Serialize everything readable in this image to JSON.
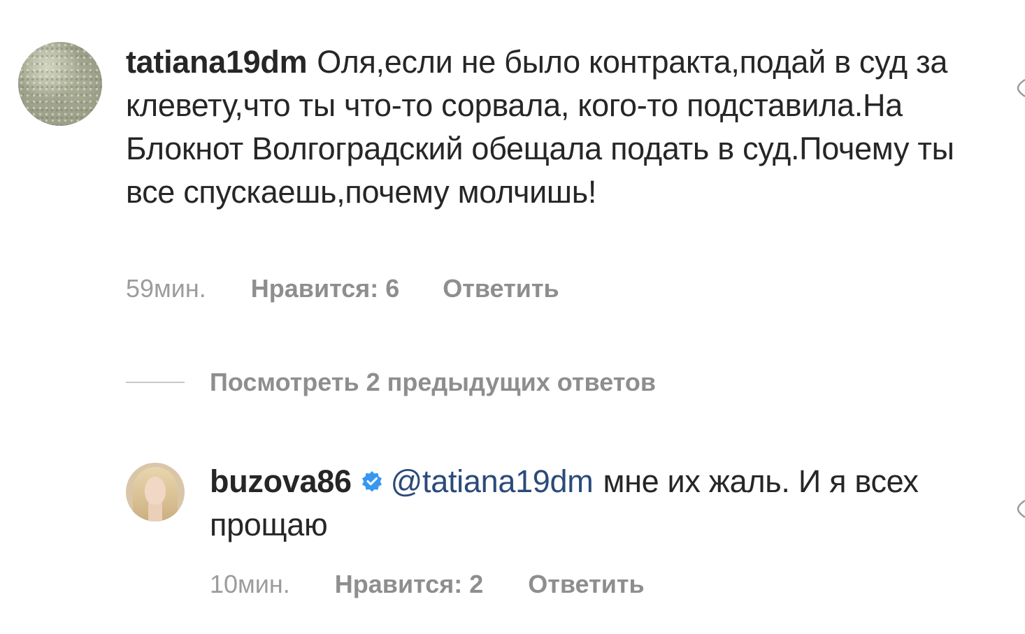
{
  "comments": [
    {
      "username": "tatiana19dm",
      "text": "Оля,если не было контракта,подай в суд за клевету,что ты что-то сорвала, кого-то подставила.На Блокнот Волгоградский обещала подать в суд.Почему ты все спускаешь,почему молчишь!",
      "time": "59мин.",
      "likes": "Нравится: 6",
      "reply": "Ответить",
      "avatar_icon": "avatar-icon"
    },
    {
      "username": "buzova86",
      "verified": true,
      "mention": "@tatiana19dm",
      "text": "мне их жаль. И я всех прощаю",
      "time": "10мин.",
      "likes": "Нравится: 2",
      "reply": "Ответить",
      "avatar_icon": "avatar-icon"
    }
  ],
  "view_replies": {
    "label": "Посмотреть 2 предыдущих ответов"
  },
  "colors": {
    "text": "#262626",
    "meta": "#8e8e8e",
    "mention": "#2b4a7a",
    "verified": "#3897f0"
  }
}
